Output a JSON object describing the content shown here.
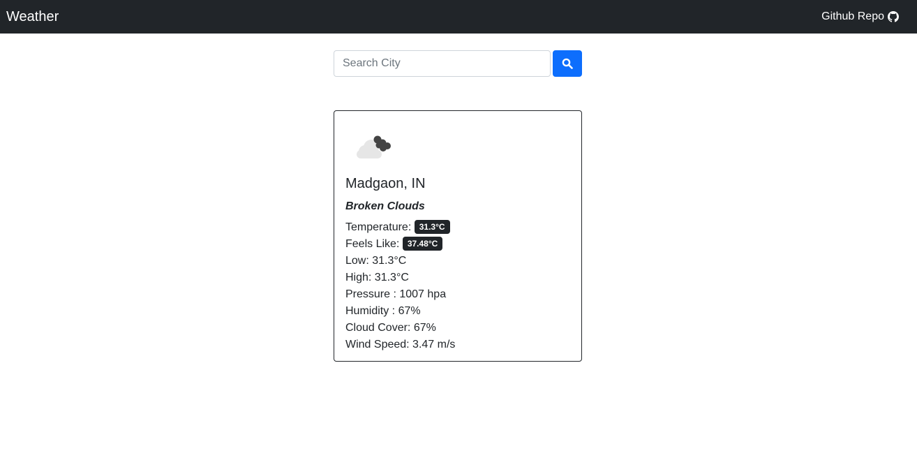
{
  "navbar": {
    "brand": "Weather",
    "repo_label": "Github Repo",
    "repo_icon": "github-icon"
  },
  "search": {
    "placeholder": "Search City",
    "value": "",
    "button_icon": "search-icon"
  },
  "weather": {
    "icon": "broken-clouds-icon",
    "city": "Madgaon, IN",
    "description": "Broken Clouds",
    "temperature_label": "Temperature:",
    "temperature_value": "31.3°C",
    "feels_like_label": "Feels Like:",
    "feels_like_value": "37.48°C",
    "low": "Low: 31.3°C",
    "high": "High: 31.3°C",
    "pressure": "Pressure : 1007 hpa",
    "humidity": "Humidity : 67%",
    "cloud_cover": "Cloud Cover: 67%",
    "wind_speed": "Wind Speed: 3.47 m/s"
  },
  "colors": {
    "navbar_bg": "#212529",
    "primary": "#0d6efd",
    "badge_bg": "#212529"
  }
}
